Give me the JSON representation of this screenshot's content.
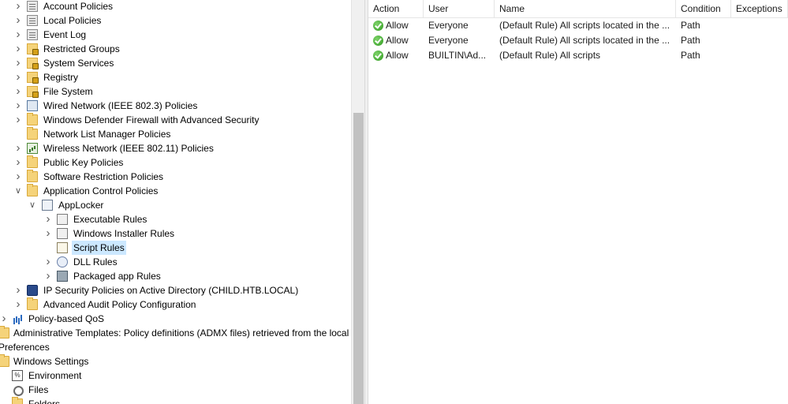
{
  "tree": {
    "items": [
      {
        "label": "Account Policies",
        "icon": "policy-icon",
        "has_children": true,
        "expanded": false
      },
      {
        "label": "Local Policies",
        "icon": "policy-icon",
        "has_children": true,
        "expanded": false
      },
      {
        "label": "Event Log",
        "icon": "policy-icon",
        "has_children": true,
        "expanded": false
      },
      {
        "label": "Restricted Groups",
        "icon": "locked-folder-icon",
        "has_children": true,
        "expanded": false
      },
      {
        "label": "System Services",
        "icon": "locked-folder-icon",
        "has_children": true,
        "expanded": false
      },
      {
        "label": "Registry",
        "icon": "locked-folder-icon",
        "has_children": true,
        "expanded": false
      },
      {
        "label": "File System",
        "icon": "locked-folder-icon",
        "has_children": true,
        "expanded": false
      },
      {
        "label": "Wired Network (IEEE 802.3) Policies",
        "icon": "network-icon",
        "has_children": true,
        "expanded": false
      },
      {
        "label": "Windows Defender Firewall with Advanced Security",
        "icon": "folder-icon",
        "has_children": true,
        "expanded": false
      },
      {
        "label": "Network List Manager Policies",
        "icon": "folder-icon",
        "has_children": false,
        "expanded": false
      },
      {
        "label": "Wireless Network (IEEE 802.11) Policies",
        "icon": "wifi-icon",
        "has_children": true,
        "expanded": false
      },
      {
        "label": "Public Key Policies",
        "icon": "folder-icon",
        "has_children": true,
        "expanded": false
      },
      {
        "label": "Software Restriction Policies",
        "icon": "folder-icon",
        "has_children": true,
        "expanded": false
      },
      {
        "label": "Application Control Policies",
        "icon": "folder-icon",
        "has_children": true,
        "expanded": true
      },
      {
        "label": "AppLocker",
        "icon": "applocker-icon",
        "has_children": true,
        "expanded": true
      },
      {
        "label": "Executable Rules",
        "icon": "rules-icon",
        "has_children": true,
        "expanded": false
      },
      {
        "label": "Windows Installer Rules",
        "icon": "installer-icon",
        "has_children": true,
        "expanded": false
      },
      {
        "label": "Script Rules",
        "icon": "script-icon",
        "has_children": false,
        "expanded": false,
        "selected": true
      },
      {
        "label": "DLL Rules",
        "icon": "dll-icon",
        "has_children": true,
        "expanded": false
      },
      {
        "label": "Packaged app Rules",
        "icon": "package-icon",
        "has_children": true,
        "expanded": false
      },
      {
        "label": "IP Security Policies on Active Directory (CHILD.HTB.LOCAL)",
        "icon": "ipsec-icon",
        "has_children": true,
        "expanded": false
      },
      {
        "label": "Advanced Audit Policy Configuration",
        "icon": "folder-icon",
        "has_children": true,
        "expanded": false
      },
      {
        "label": "Policy-based QoS",
        "icon": "qos-icon",
        "has_children": true,
        "expanded": false
      },
      {
        "label": "Administrative Templates: Policy definitions (ADMX files) retrieved from the local",
        "icon": "folder-icon",
        "has_children": false,
        "expanded": false
      },
      {
        "label": "Preferences",
        "icon": "none",
        "has_children": false,
        "expanded": false
      },
      {
        "label": "Windows Settings",
        "icon": "folder-icon",
        "has_children": false,
        "expanded": false
      },
      {
        "label": "Environment",
        "icon": "environment-icon",
        "has_children": false,
        "expanded": false
      },
      {
        "label": "Files",
        "icon": "files-icon",
        "has_children": false,
        "expanded": false
      },
      {
        "label": "Folders",
        "icon": "folder-icon",
        "has_children": false,
        "expanded": false
      }
    ]
  },
  "list": {
    "columns": [
      "Action",
      "User",
      "Name",
      "Condition",
      "Exceptions"
    ],
    "rows": [
      {
        "action": "Allow",
        "user": "Everyone",
        "name": "(Default Rule) All scripts located in the ...",
        "condition": "Path",
        "exceptions": ""
      },
      {
        "action": "Allow",
        "user": "Everyone",
        "name": "(Default Rule) All scripts located in the ...",
        "condition": "Path",
        "exceptions": ""
      },
      {
        "action": "Allow",
        "user": "BUILTIN\\Ad...",
        "name": "(Default Rule) All scripts",
        "condition": "Path",
        "exceptions": ""
      }
    ]
  },
  "colors": {
    "selection": "#cce8ff",
    "allow_icon": "#2e9a1e",
    "folder": "#f5d37a"
  }
}
